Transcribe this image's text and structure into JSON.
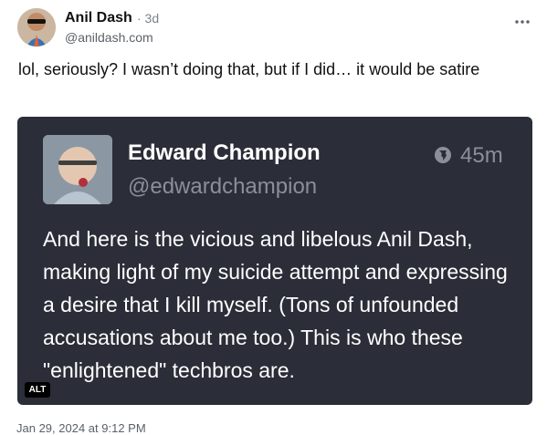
{
  "author": {
    "name": "Anil Dash",
    "time": "· 3d",
    "handle": "@anildash.com"
  },
  "post": {
    "text": "lol, seriously? I wasn’t doing that, but if I did… it would be satire"
  },
  "embed": {
    "name": "Edward Champion",
    "handle": "@edwardchampion",
    "time": "45m",
    "text": "And here is the vicious and libelous Anil Dash, making light of my suicide attempt and expressing a desire that I kill myself. (Tons of unfounded accusations about me too.) This is who these \"enlightened\" techbros are."
  },
  "alt_badge": "ALT",
  "timestamp": "Jan 29, 2024 at 9:12 PM",
  "colors": {
    "embed_background": "#2b2e38",
    "muted_text": "#8a8f99"
  },
  "icons": {
    "more": "more-dots-icon",
    "globe": "globe-icon"
  }
}
